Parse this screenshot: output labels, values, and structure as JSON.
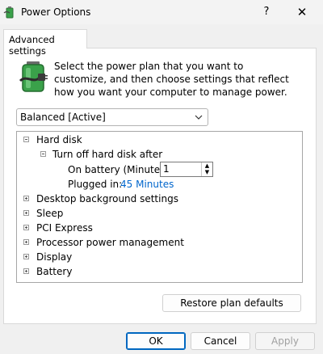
{
  "window": {
    "title": "Power Options",
    "help_label": "?",
    "close_label": "✕",
    "app_icon": "power-options-icon"
  },
  "tab": {
    "label": "Advanced settings"
  },
  "description": "Select the power plan that you want to customize, and then choose settings that reflect how you want your computer to manage power.",
  "plan_select": {
    "value": "Balanced [Active]",
    "icon": "chevron-down-icon"
  },
  "tree": {
    "hard_disk": "Hard disk",
    "turn_off": "Turn off hard disk after",
    "on_battery_label": "On battery (Minute):",
    "on_battery_value": "1",
    "plugged_in_label": "Plugged in:",
    "plugged_in_value": "45 Minutes",
    "collapsed": [
      "Desktop background settings",
      "Sleep",
      "PCI Express",
      "Processor power management",
      "Display",
      "Battery"
    ]
  },
  "buttons": {
    "restore": "Restore plan defaults",
    "ok": "OK",
    "cancel": "Cancel",
    "apply": "Apply"
  },
  "colors": {
    "link": "#0066cc",
    "accent": "#0067c0",
    "battery_green": "#3aa14a"
  }
}
